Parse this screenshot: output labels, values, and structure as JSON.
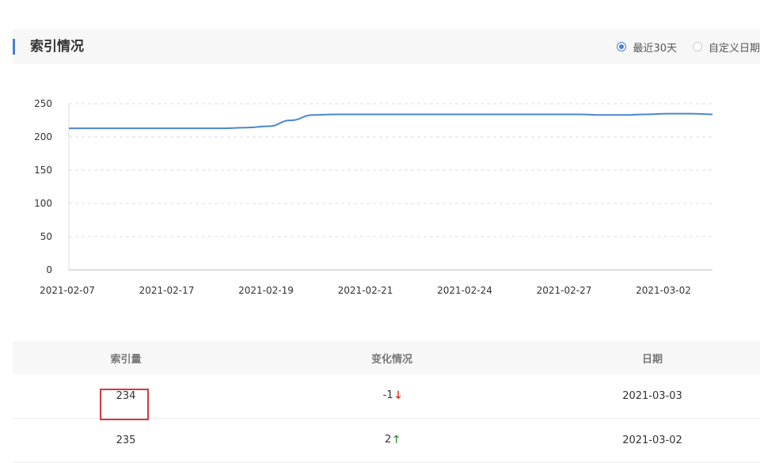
{
  "header": {
    "title": "索引情况",
    "range_options": [
      {
        "label": "最近30天",
        "checked": true
      },
      {
        "label": "自定义日期",
        "checked": false
      }
    ]
  },
  "chart_data": {
    "type": "line",
    "title": "",
    "xlabel": "",
    "ylabel": "",
    "ylim": [
      0,
      250
    ],
    "yticks": [
      "250",
      "200",
      "150",
      "100",
      "50",
      "0"
    ],
    "x_tick_labels": [
      "2021-02-07",
      "2021-02-17",
      "2021-02-19",
      "2021-02-21",
      "2021-02-24",
      "2021-02-27",
      "2021-03-02"
    ],
    "grid": true,
    "series": [
      {
        "name": "",
        "color": "#4a86d4",
        "values": [
          213,
          213,
          213,
          213,
          213,
          213,
          213,
          213,
          214,
          216,
          225,
          233,
          234,
          234,
          234,
          234,
          234,
          234,
          234,
          234,
          234,
          234,
          234,
          234,
          233,
          233,
          234,
          235,
          235,
          234
        ]
      }
    ]
  },
  "table": {
    "headers": [
      "索引量",
      "变化情况",
      "日期"
    ],
    "rows": [
      {
        "count": "234",
        "change": "-1",
        "direction": "down",
        "date": "2021-03-03"
      },
      {
        "count": "235",
        "change": "2",
        "direction": "up",
        "date": "2021-03-02"
      }
    ]
  }
}
